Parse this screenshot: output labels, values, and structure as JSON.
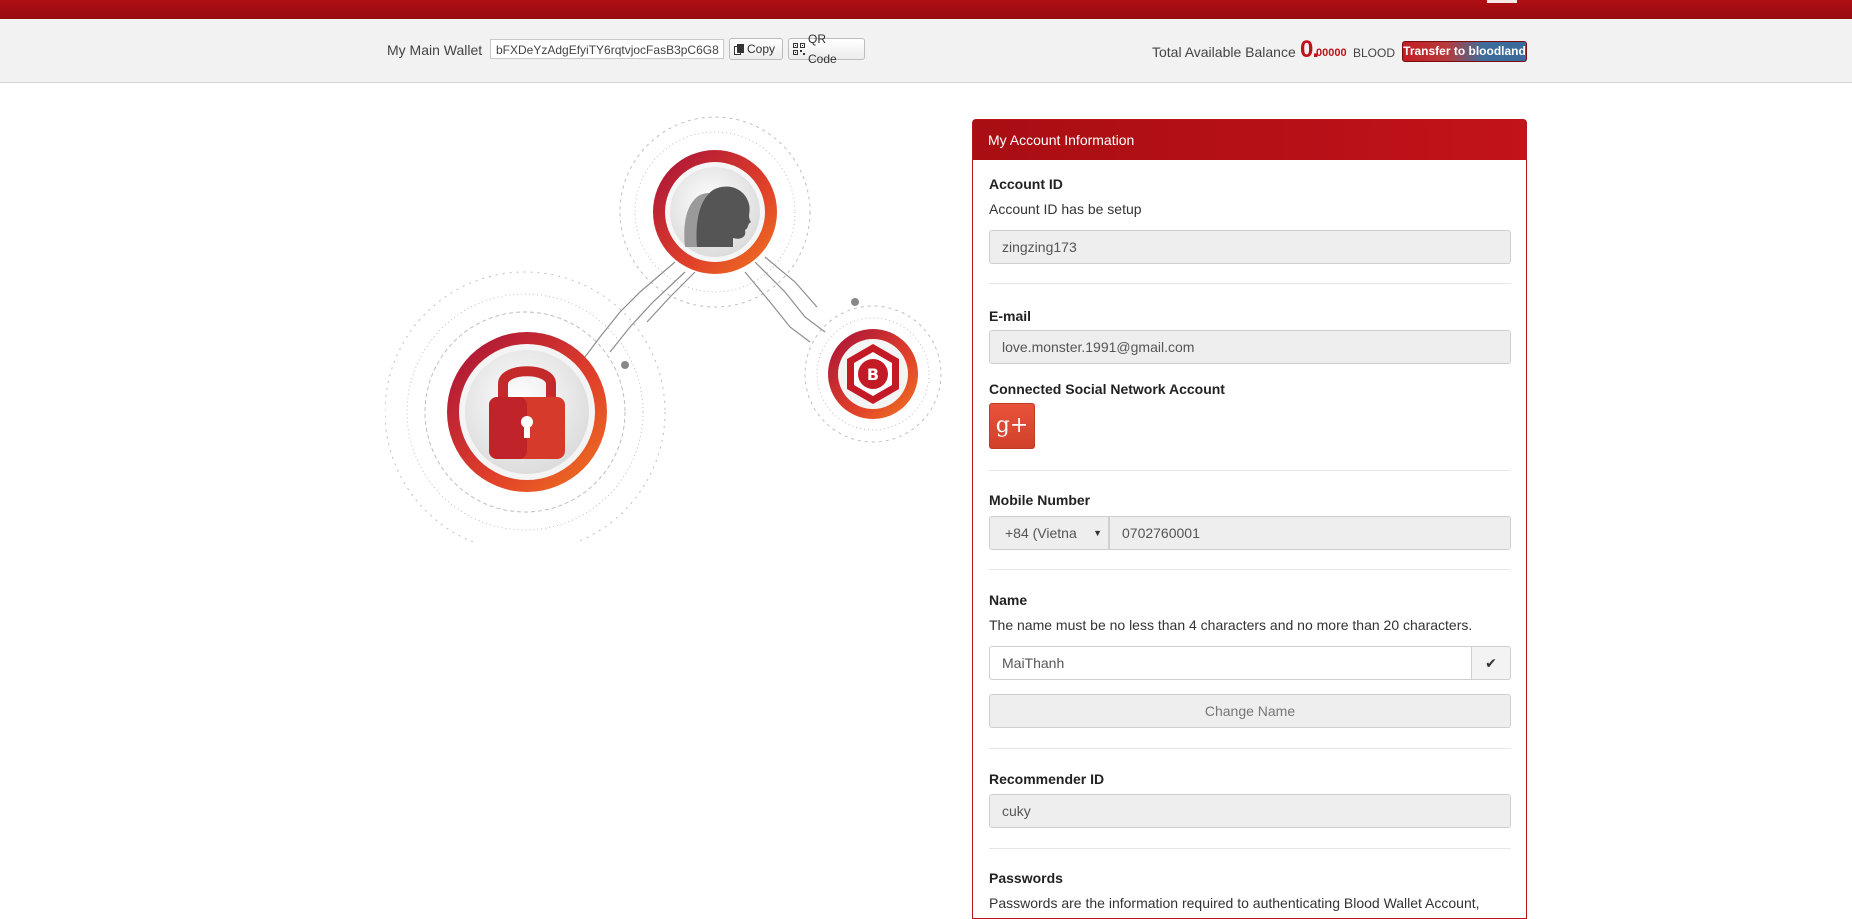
{
  "wallet": {
    "label": "My Main Wallet",
    "address": "bFXDeYzAdgEfyiTY6rqtvjocFasB3pC6G8",
    "copy_label": "Copy",
    "qr_label": "QR Code",
    "balance_label": "Total Available Balance",
    "balance_integer": "0.",
    "balance_decimal": "00000",
    "balance_unit": "BLOOD",
    "transfer_label": "Transfer to bloodland"
  },
  "account": {
    "panel_title": "My Account Information",
    "account_id": {
      "label": "Account ID",
      "help": "Account ID has be setup",
      "value": "zingzing173"
    },
    "email": {
      "label": "E-mail",
      "value": "love.monster.1991@gmail.com"
    },
    "social": {
      "label": "Connected Social Network Account",
      "button_glyph": "g+"
    },
    "mobile": {
      "label": "Mobile Number",
      "country": "+84 (Vietna",
      "number": "0702760001"
    },
    "name": {
      "label": "Name",
      "help": "The name must be no less than 4 characters and no more than 20 characters.",
      "value": "MaiThanh",
      "change_label": "Change Name"
    },
    "recommender": {
      "label": "Recommender ID",
      "value": "cuky"
    },
    "passwords": {
      "label": "Passwords",
      "help": "Passwords are the information required to authenticating Blood Wallet Account,"
    }
  },
  "colors": {
    "brand_red": "#b00e14",
    "balance_red": "#c0121a",
    "gplus": "#dd4b39"
  },
  "icons": [
    "menu-icon",
    "copy-icon",
    "qr-code-icon",
    "user-head-icon",
    "lock-icon",
    "b-coin-icon",
    "checkmark-icon",
    "google-plus-icon",
    "caret-down-icon"
  ]
}
